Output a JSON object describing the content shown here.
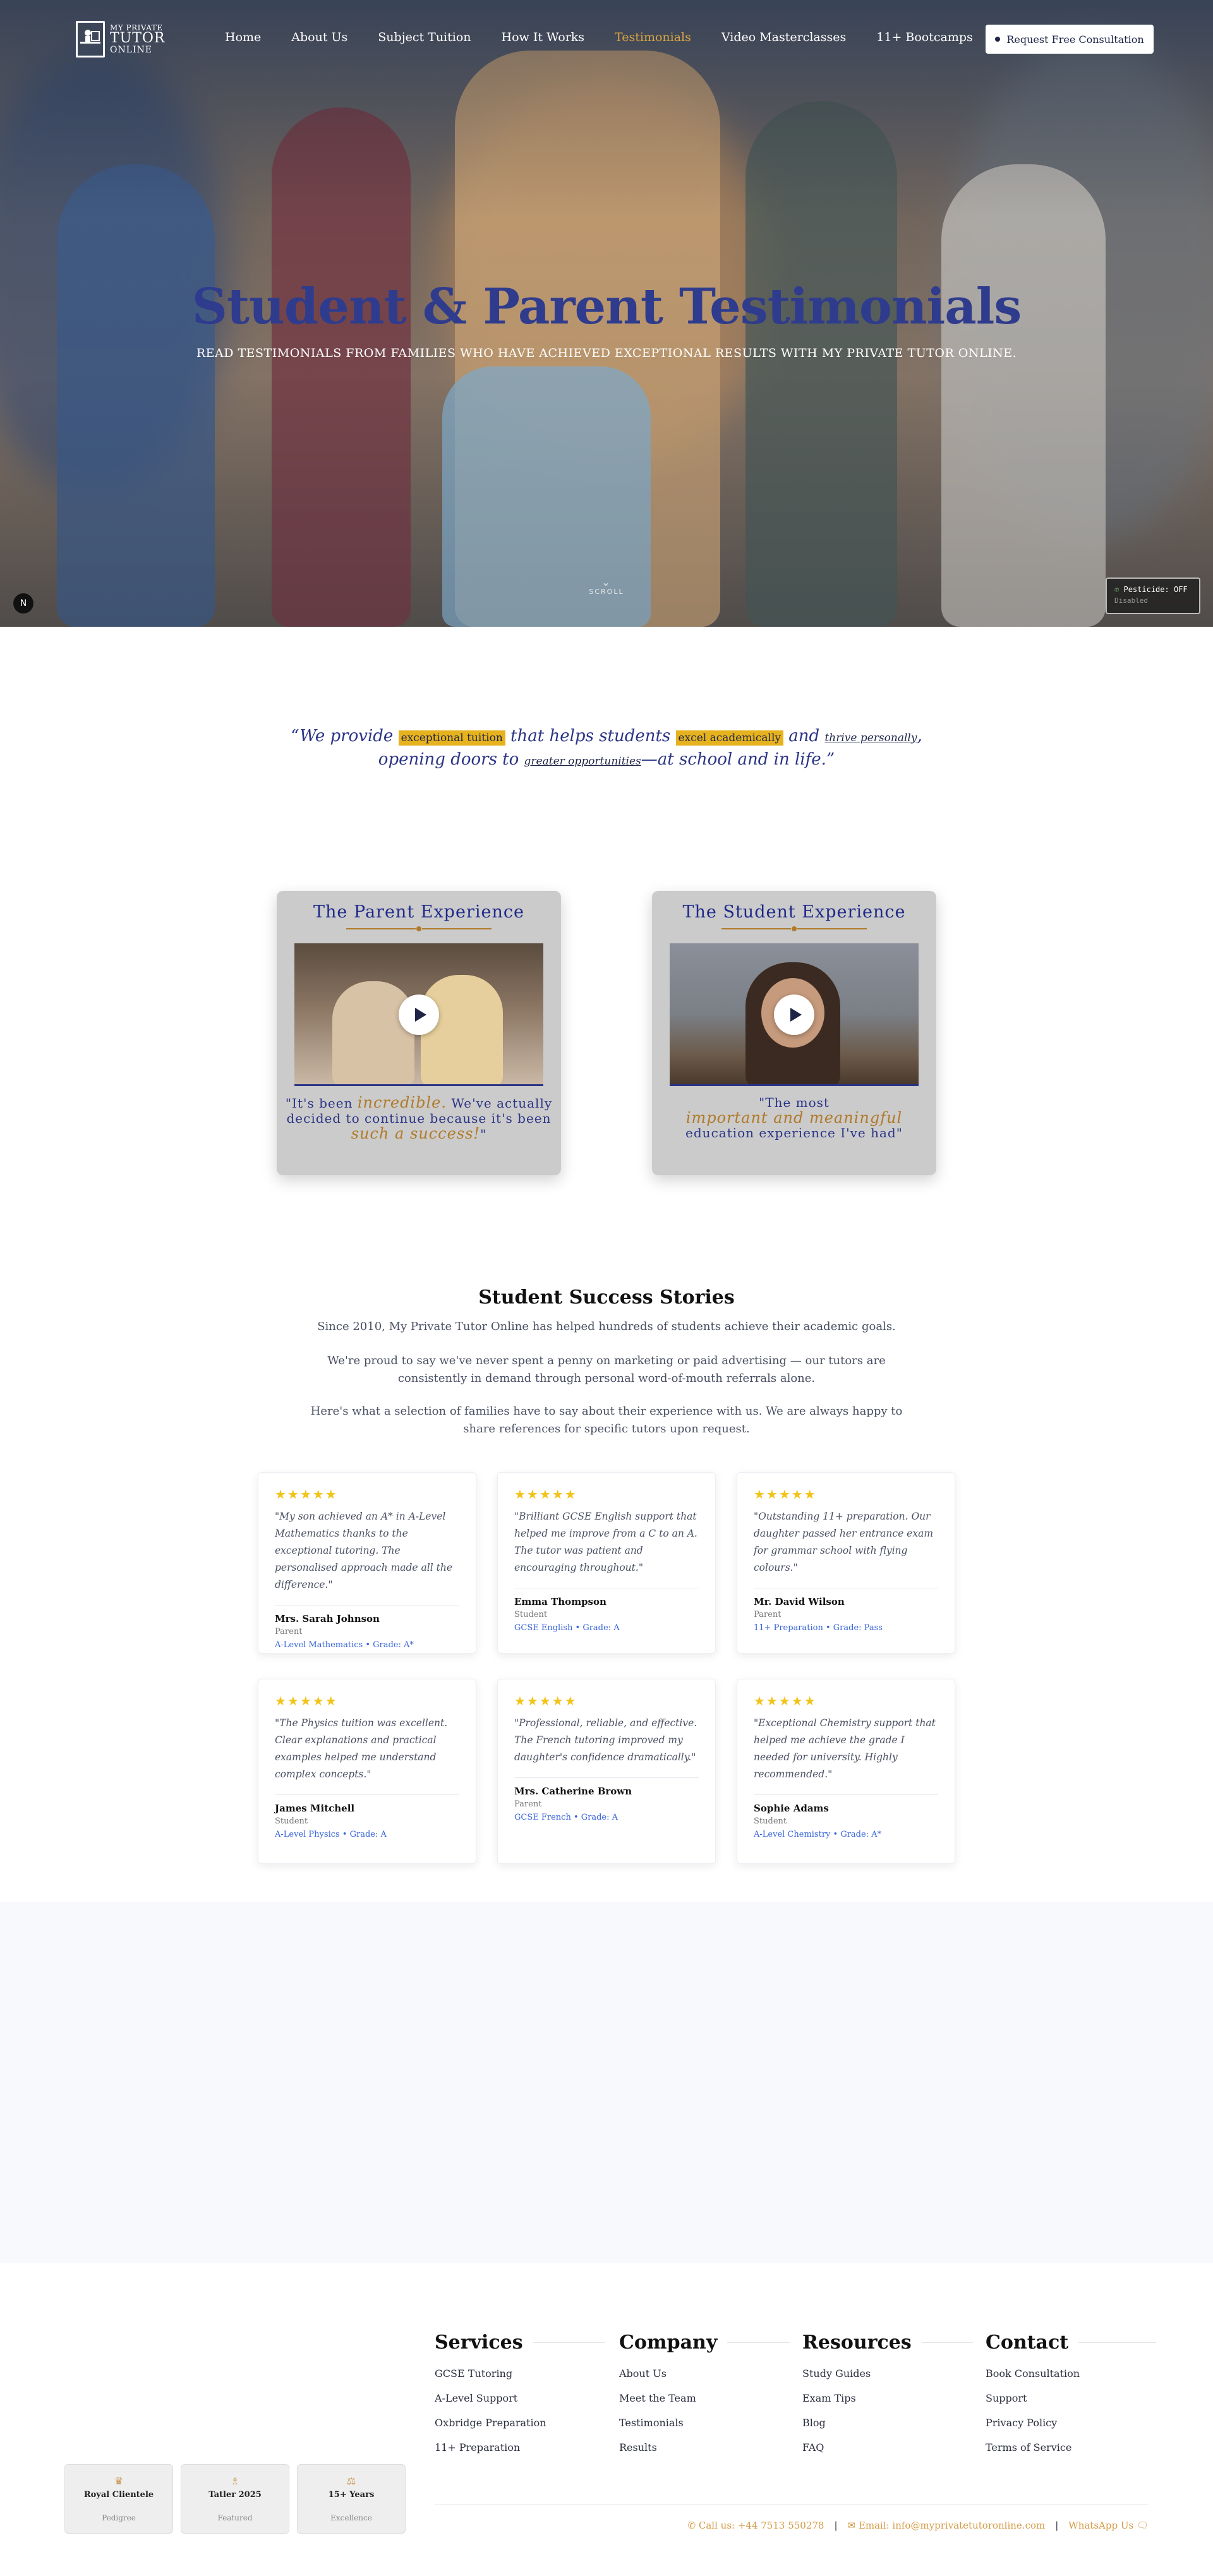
{
  "brand": {
    "logo_line1": "MY PRIVATE",
    "logo_line2": "TUTOR",
    "logo_line3": "ONLINE"
  },
  "nav": {
    "items": [
      {
        "label": "Home",
        "active": false
      },
      {
        "label": "About Us",
        "active": false
      },
      {
        "label": "Subject Tuition",
        "active": false
      },
      {
        "label": "How It Works",
        "active": false
      },
      {
        "label": "Testimonials",
        "active": true
      },
      {
        "label": "Video Masterclasses",
        "active": false
      },
      {
        "label": "11+ Bootcamps",
        "active": false
      }
    ],
    "cta_label": "Request Free Consultation"
  },
  "hero": {
    "title": "Student & Parent Testimonials",
    "subtitle": "READ TESTIMONIALS FROM FAMILIES WHO HAVE ACHIEVED EXCEPTIONAL RESULTS WITH MY PRIVATE TUTOR ONLINE.",
    "scroll_label": "SCROLL",
    "n_badge": "N",
    "pesticide_label": "Pesticide: OFF",
    "pesticide_sub": "Disabled"
  },
  "quote": {
    "p1": "“We provide ",
    "hl1": "exceptional tuition",
    "p2": " that helps students ",
    "hl2": "excel academically",
    "p3": " and ",
    "ul1": "thrive personally",
    "p4": ",",
    "p5": "opening doors to ",
    "ul2": "greater opportunities",
    "p6": "—at school and in life.”"
  },
  "experience": [
    {
      "title": "The Parent Experience",
      "q1": "\"It's been ",
      "acc1": "incredible.",
      "q2": " We've actually",
      "q3": "decided to continue because it's been",
      "acc2": "such a success!",
      "q4": "\""
    },
    {
      "title": "The Student Experience",
      "q1": "\"The most",
      "acc1": "important and meaningful",
      "q2": "",
      "q3": "education experience I've had\"",
      "acc2": "",
      "q4": ""
    }
  ],
  "success": {
    "title": "Student Success Stories",
    "p1": "Since 2010, My Private Tutor Online has helped hundreds of students achieve their academic goals.",
    "p2": "We're proud to say we've never spent a penny on marketing or paid advertising — our tutors are consistently in demand through personal word-of-mouth referrals alone.",
    "p3": "Here's what a selection of families have to say about their experience with us. We are always happy to share references for specific tutors upon request.",
    "stars": "★★★★★",
    "testimonials": [
      {
        "text": "\"My son achieved an A* in A-Level Mathematics thanks to the exceptional tutoring. The personalised approach made all the difference.\"",
        "name": "Mrs. Sarah Johnson",
        "role": "Parent",
        "meta": "A-Level Mathematics • Grade: A*"
      },
      {
        "text": "\"Brilliant GCSE English support that helped me improve from a C to an A. The tutor was patient and encouraging throughout.\"",
        "name": "Emma Thompson",
        "role": "Student",
        "meta": "GCSE English • Grade: A"
      },
      {
        "text": "\"Outstanding 11+ preparation. Our daughter passed her entrance exam for grammar school with flying colours.\"",
        "name": "Mr. David Wilson",
        "role": "Parent",
        "meta": "11+ Preparation • Grade: Pass"
      },
      {
        "text": "\"The Physics tuition was excellent. Clear explanations and practical examples helped me understand complex concepts.\"",
        "name": "James Mitchell",
        "role": "Student",
        "meta": "A-Level Physics • Grade: A"
      },
      {
        "text": "\"Professional, reliable, and effective. The French tutoring improved my daughter's confidence dramatically.\"",
        "name": "Mrs. Catherine Brown",
        "role": "Parent",
        "meta": "GCSE French • Grade: A"
      },
      {
        "text": "\"Exceptional Chemistry support that helped me achieve the grade I needed for university. Highly recommended.\"",
        "name": "Sophie Adams",
        "role": "Student",
        "meta": "A-Level Chemistry • Grade: A*"
      }
    ]
  },
  "footer": {
    "columns": [
      {
        "heading": "Services",
        "links": [
          "GCSE Tutoring",
          "A-Level Support",
          "Oxbridge Preparation",
          "11+ Preparation"
        ]
      },
      {
        "heading": "Company",
        "links": [
          "About Us",
          "Meet the Team",
          "Testimonials",
          "Results"
        ]
      },
      {
        "heading": "Resources",
        "links": [
          "Study Guides",
          "Exam Tips",
          "Blog",
          "FAQ"
        ]
      },
      {
        "heading": "Contact",
        "links": [
          "Book Consultation",
          "Support",
          "Privacy Policy",
          "Terms of Service"
        ]
      }
    ],
    "badges": [
      {
        "icon": "♛",
        "title": "Royal Clientele",
        "sub": "Pedigree"
      },
      {
        "icon": "♗",
        "title": "Tatler 2025",
        "sub": "Featured"
      },
      {
        "icon": "⚖",
        "title": "15+ Years",
        "sub": "Excellence"
      }
    ],
    "phone": "Call us: +44 7513 550278",
    "email": "Email: info@myprivatetutoronline.com",
    "whatsapp": "WhatsApp Us",
    "pipe": "|"
  },
  "colors": {
    "accent_gold": "#d9a441",
    "navy": "#2b3486",
    "highlight": "#e6b21e",
    "link_blue": "#3864d8",
    "star": "#f2c318"
  }
}
